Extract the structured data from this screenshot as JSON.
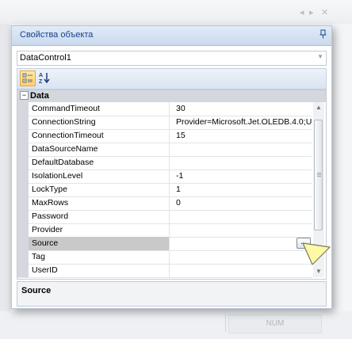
{
  "panel": {
    "title": "Свойства объекта",
    "pin_icon": "pin-icon"
  },
  "object_selector": {
    "value": "DataControl1"
  },
  "toolbar": {
    "categorized_icon": "categorized-icon",
    "alphabetical_icon": "sort-alphabetical-icon"
  },
  "grid": {
    "category": "Data",
    "rows": [
      {
        "name": "CommandTimeout",
        "value": "30"
      },
      {
        "name": "ConnectionString",
        "value": "Provider=Microsoft.Jet.OLEDB.4.0;U"
      },
      {
        "name": "ConnectionTimeout",
        "value": "15"
      },
      {
        "name": "DataSourceName",
        "value": ""
      },
      {
        "name": "DefaultDatabase",
        "value": ""
      },
      {
        "name": "IsolationLevel",
        "value": "-1"
      },
      {
        "name": "LockType",
        "value": "1"
      },
      {
        "name": "MaxRows",
        "value": "0"
      },
      {
        "name": "Password",
        "value": ""
      },
      {
        "name": "Provider",
        "value": ""
      },
      {
        "name": "Source",
        "value": ""
      },
      {
        "name": "Tag",
        "value": ""
      },
      {
        "name": "UserID",
        "value": ""
      }
    ],
    "selected_index": 10,
    "ellipsis_label": "..."
  },
  "description": {
    "title": "Source"
  },
  "statusbar": {
    "num": "NUM"
  }
}
